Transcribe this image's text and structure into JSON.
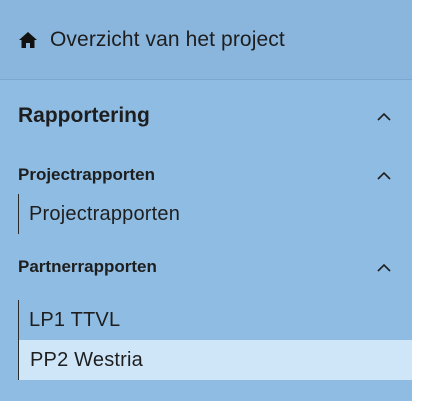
{
  "nav": {
    "overview": {
      "label": "Overzicht van het project",
      "icon": "home-icon"
    },
    "reporting": {
      "label": "Rapportering",
      "icon": "chevron-up-icon",
      "groups": [
        {
          "label": "Projectrapporten",
          "icon": "chevron-up-icon",
          "items": [
            "Projectrapporten"
          ]
        },
        {
          "label": "Partnerrapporten",
          "icon": "chevron-up-icon",
          "items": [
            "LP1 TTVL",
            "PP2 Westria"
          ],
          "active_item": "PP2 Westria"
        }
      ]
    }
  },
  "colors": {
    "sidebar_bg": "#8fbce2",
    "active_bg": "#cfe6f9",
    "text": "#1e1e1e"
  }
}
